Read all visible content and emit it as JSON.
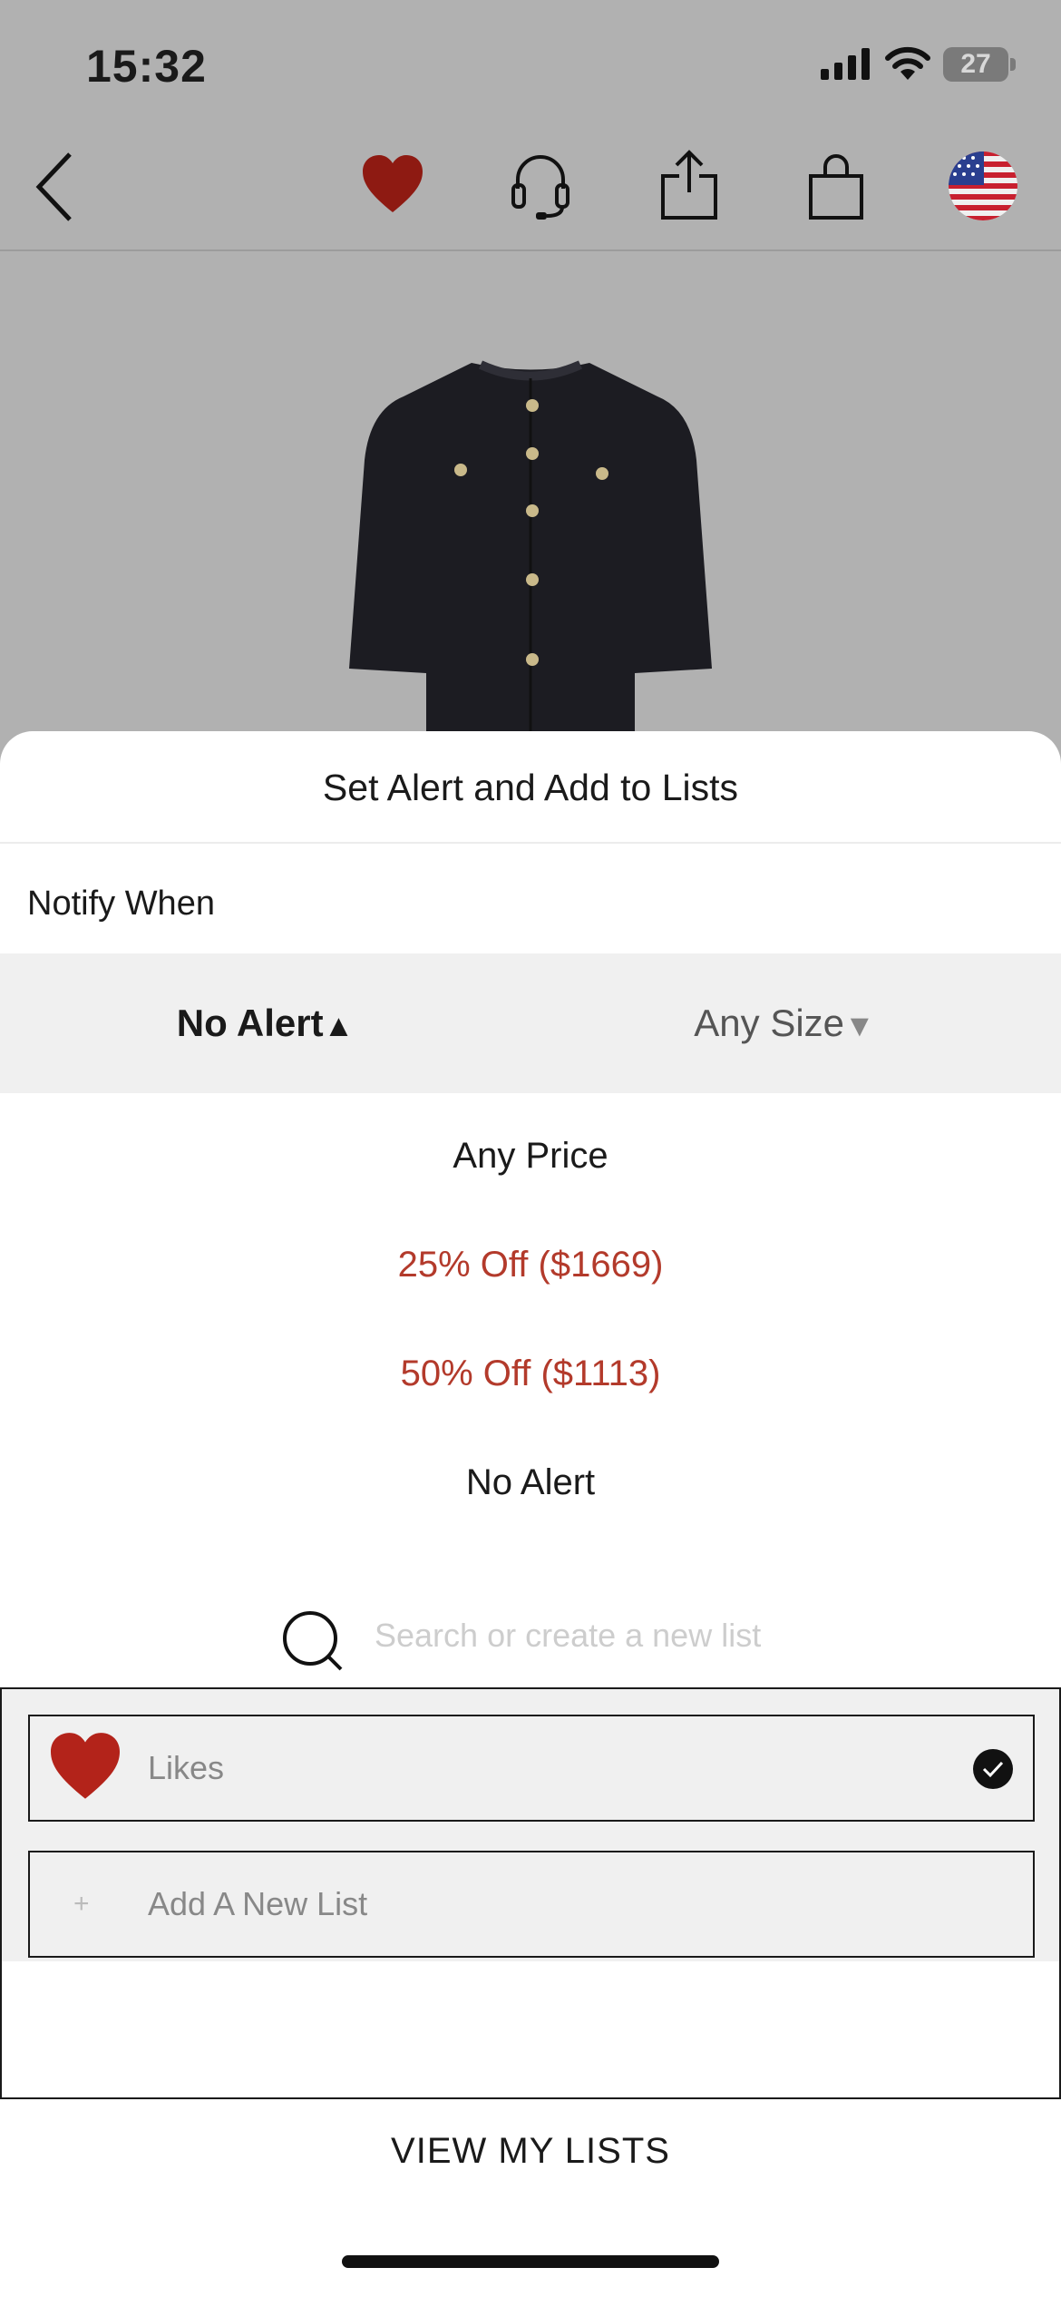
{
  "status_bar": {
    "time": "15:32",
    "battery": "27"
  },
  "nav": {
    "icons": [
      "back-chevron-icon",
      "heart-icon",
      "headset-icon",
      "share-icon",
      "shopping-bag-icon",
      "us-flag-icon"
    ]
  },
  "product": {
    "image": "black-tweed-cardigan"
  },
  "sheet": {
    "title": "Set Alert and Add to Lists",
    "notify_label": "Notify When",
    "alert_selector": {
      "label": "No Alert",
      "arrow": "▲"
    },
    "size_selector": {
      "label": "Any Size",
      "arrow": "▼"
    },
    "options": [
      {
        "label": "Any Price",
        "color": "#1a1a1a"
      },
      {
        "label": "25% Off ($1669)",
        "color": "#b33a2b"
      },
      {
        "label": "50% Off ($1113)",
        "color": "#b33a2b"
      },
      {
        "label": "No Alert",
        "color": "#1a1a1a"
      }
    ],
    "search": {
      "placeholder": "Search or create a new list"
    },
    "lists": [
      {
        "label": "Likes",
        "icon": "heart-icon",
        "checked": true
      },
      {
        "label": "Add A New List",
        "icon": "plus-icon",
        "checked": false
      }
    ],
    "view_lists": "VIEW MY LISTS"
  },
  "colors": {
    "accent_red": "#b3231a",
    "overlay_gray": "#b1b1b1"
  }
}
